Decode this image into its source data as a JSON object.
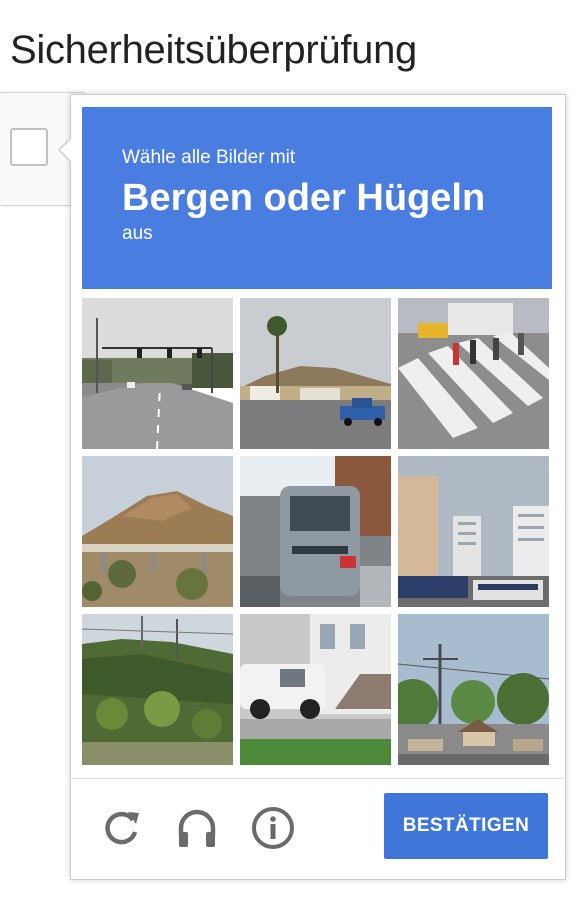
{
  "page": {
    "title": "Sicherheitsüberprüfung"
  },
  "challenge": {
    "instruction_line1": "Wähle alle Bilder mit",
    "keyword": "Bergen oder Hügeln",
    "instruction_line3": "aus",
    "header_color": "#4a7de0"
  },
  "tiles": [
    {
      "scene": "road-with-traffic-lights"
    },
    {
      "scene": "palm-tree-hill-blue-pickup"
    },
    {
      "scene": "crosswalk-pedestrians-taxi"
    },
    {
      "scene": "brown-mountain-overpass"
    },
    {
      "scene": "silver-van-closeup"
    },
    {
      "scene": "tall-buildings-buses"
    },
    {
      "scene": "green-hill-palms-power-lines"
    },
    {
      "scene": "white-pickup-building-steps"
    },
    {
      "scene": "trees-power-pole-houses"
    }
  ],
  "footer": {
    "reload_icon": "reload-icon",
    "audio_icon": "headphones-icon",
    "info_icon": "info-icon",
    "verify_label": "BESTÄTIGEN",
    "verify_color": "#3f76d8"
  }
}
